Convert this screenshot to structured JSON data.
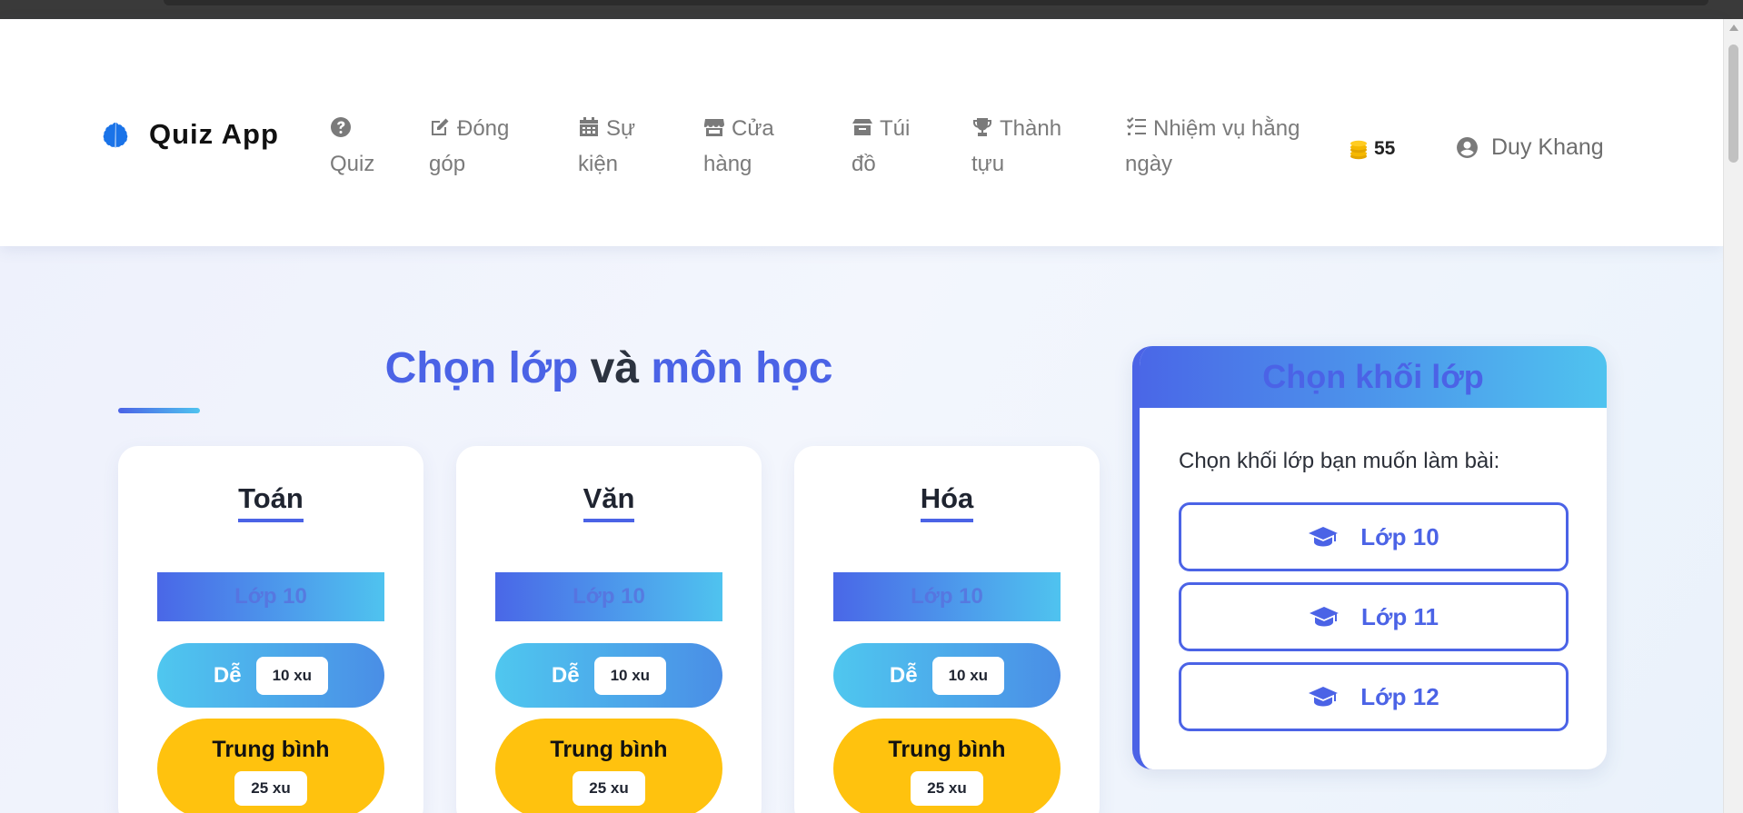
{
  "brand": {
    "name": "Quiz App",
    "icon": "brain-icon",
    "icon_color": "#1a73e8"
  },
  "nav": [
    {
      "icon": "question-circle-icon",
      "line1": "Quiz",
      "line2": ""
    },
    {
      "icon": "edit-icon",
      "line1": "Đóng",
      "line2": "góp"
    },
    {
      "icon": "calendar-icon",
      "line1": "Sự",
      "line2": "kiện"
    },
    {
      "icon": "store-icon",
      "line1": "Cửa",
      "line2": "hàng"
    },
    {
      "icon": "box-icon",
      "line1": "Túi",
      "line2": "đồ"
    },
    {
      "icon": "trophy-icon",
      "line1": "Thành",
      "line2": "tựu"
    },
    {
      "icon": "tasks-icon",
      "line1": "Nhiệm vụ hằng",
      "line2": "ngày"
    }
  ],
  "coins": {
    "icon": "coins-icon",
    "value": "55"
  },
  "user": {
    "icon": "user-circle-icon",
    "name": "Duy Khang"
  },
  "heading": {
    "part1": "Chọn lớp",
    "part2": " và ",
    "part3": "môn học"
  },
  "subjects": [
    {
      "name": "Toán",
      "grade": "Lớp 10",
      "easy_label": "Dễ",
      "easy_reward": "10 xu",
      "medium_label": "Trung bình",
      "medium_reward": "25 xu"
    },
    {
      "name": "Văn",
      "grade": "Lớp 10",
      "easy_label": "Dễ",
      "easy_reward": "10 xu",
      "medium_label": "Trung bình",
      "medium_reward": "25 xu"
    },
    {
      "name": "Hóa",
      "grade": "Lớp 10",
      "easy_label": "Dễ",
      "easy_reward": "10 xu",
      "medium_label": "Trung bình",
      "medium_reward": "25 xu"
    }
  ],
  "grade_panel": {
    "title": "Chọn khối lớp",
    "prompt": "Chọn khối lớp bạn muốn làm bài:",
    "options": [
      {
        "icon": "graduation-cap-icon",
        "label": "Lớp 10"
      },
      {
        "icon": "graduation-cap-icon",
        "label": "Lớp 11"
      },
      {
        "icon": "graduation-cap-icon",
        "label": "Lớp 12"
      }
    ]
  },
  "colors": {
    "accent": "#4b63e6",
    "accent_light": "#4fc3ef",
    "medium": "#ffc20e",
    "coin": "#f5b800"
  }
}
